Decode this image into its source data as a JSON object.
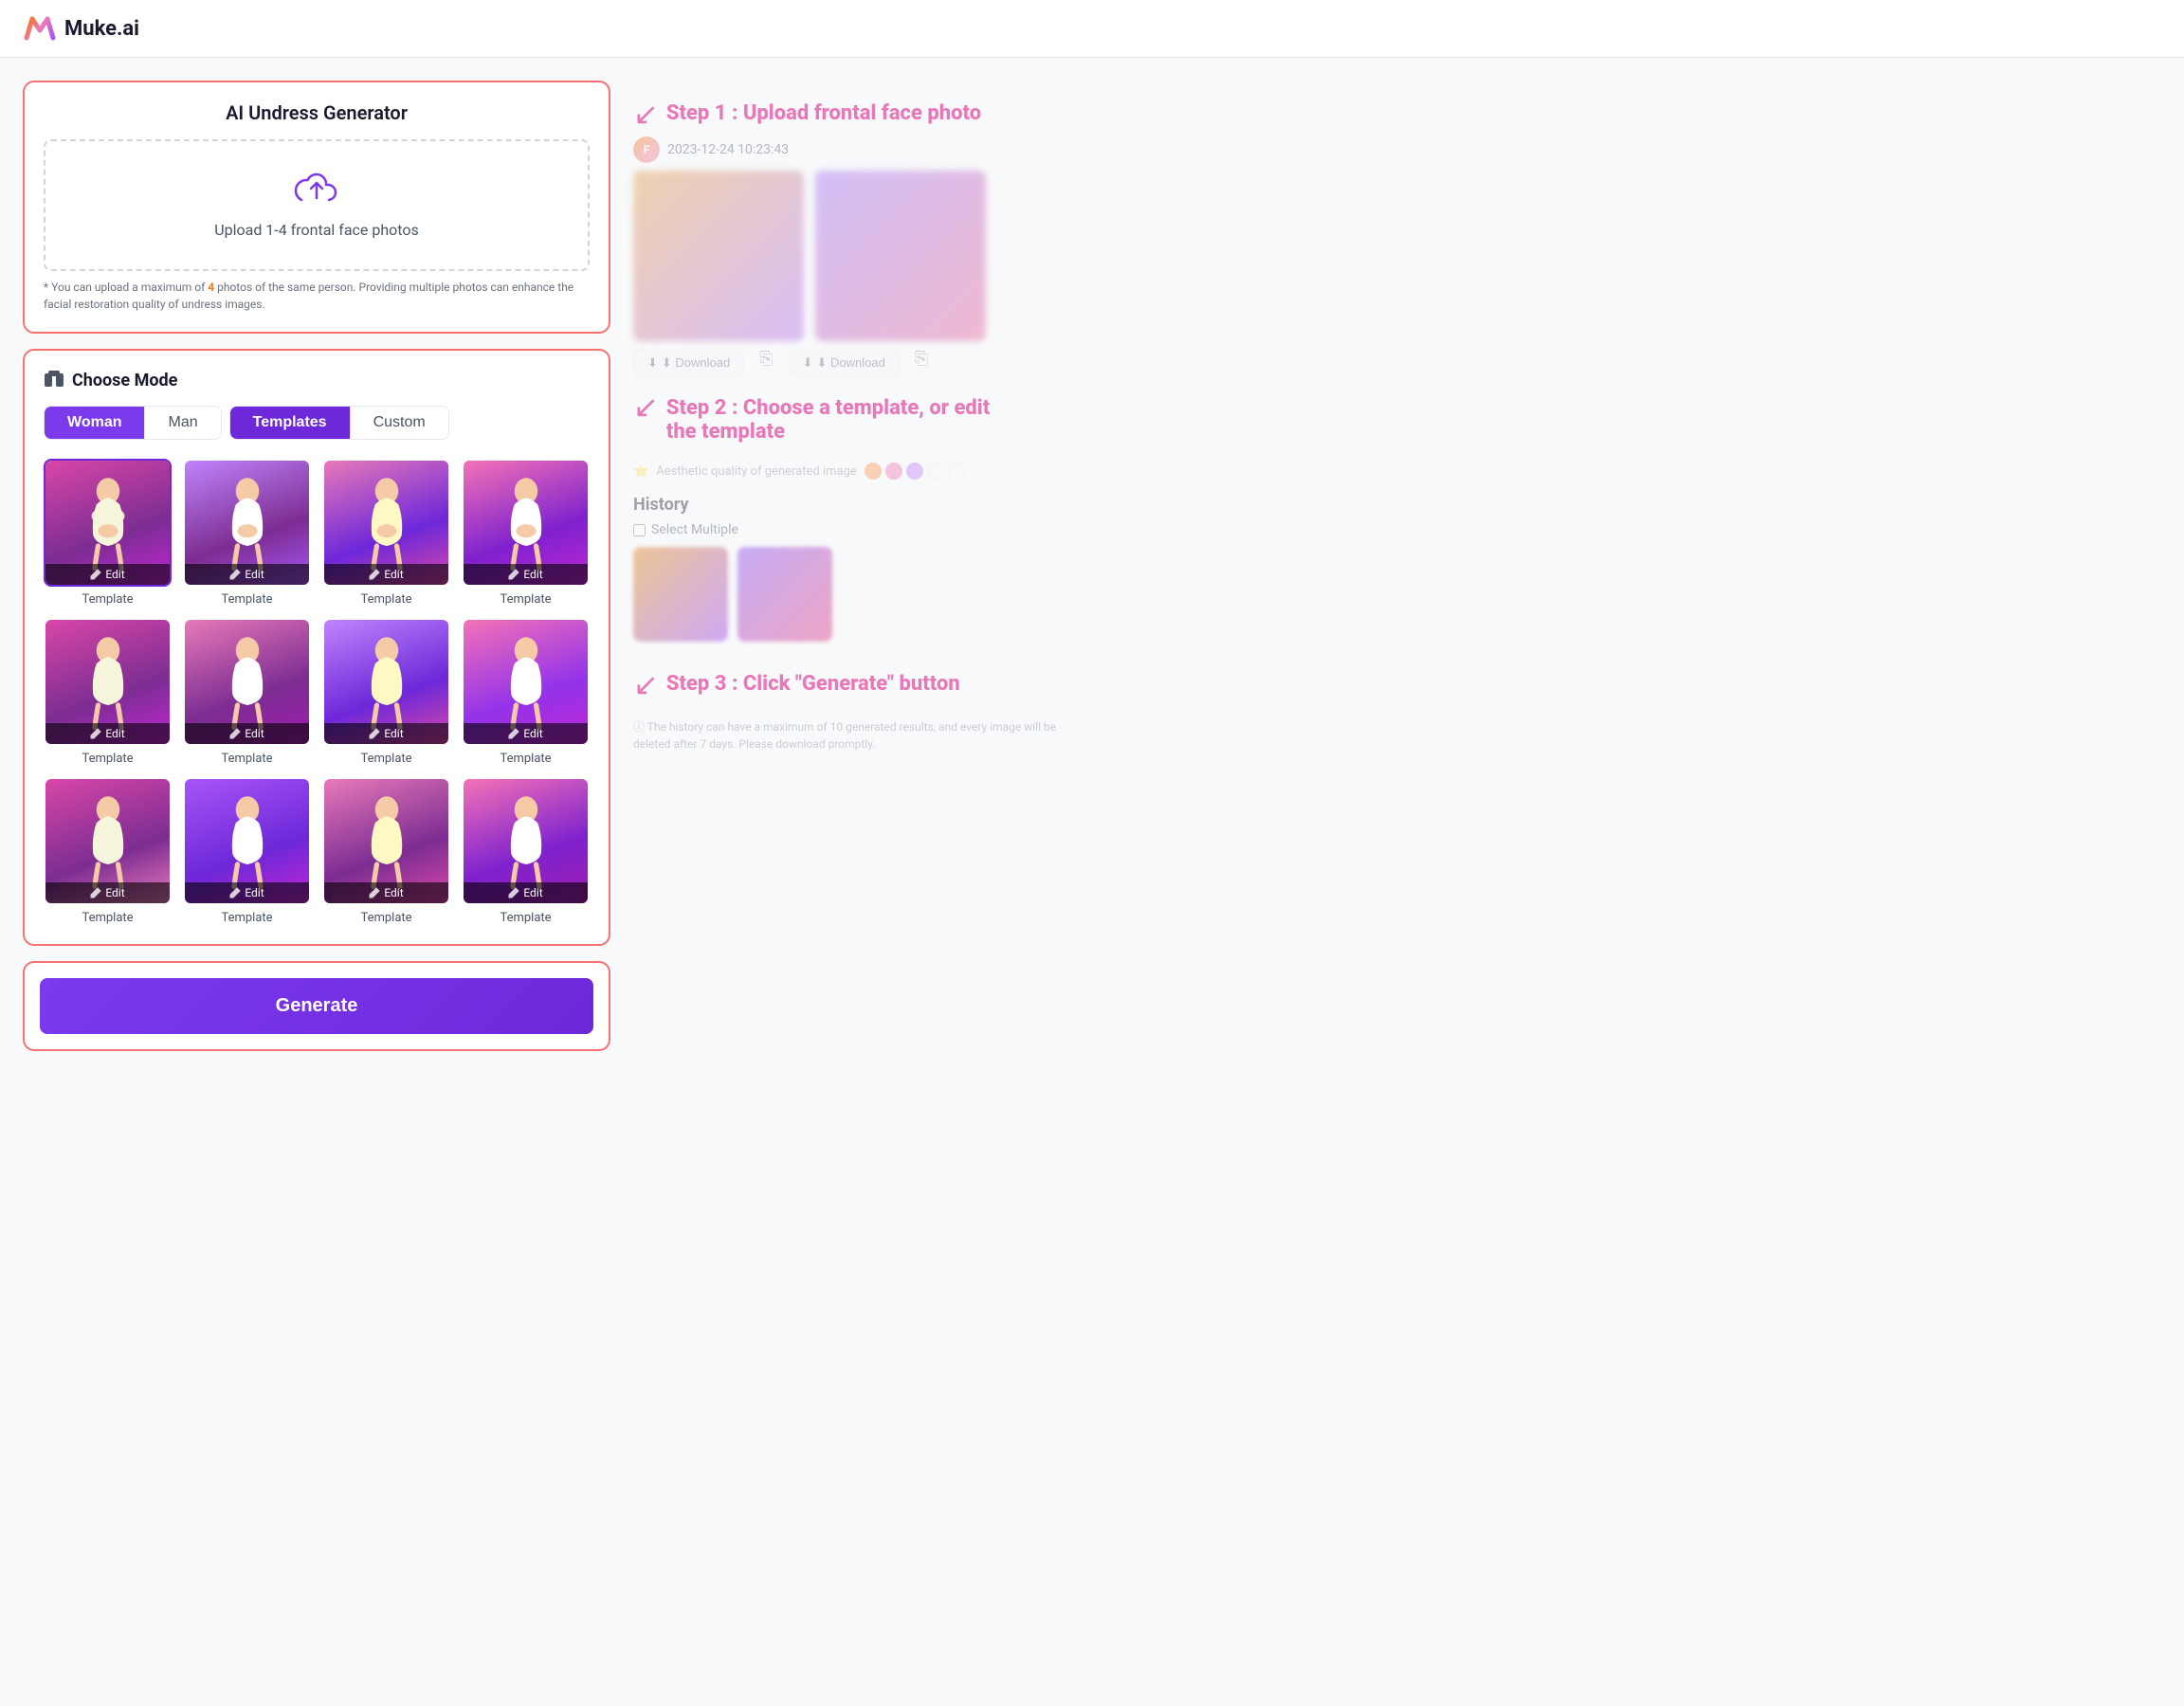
{
  "header": {
    "logo_text": "Muke.ai"
  },
  "upload_section": {
    "title": "AI Undress Generator",
    "upload_text": "Upload 1-4 frontal face photos",
    "hint": "* You can upload a maximum of 4 photos of the same person. Providing multiple photos can enhance the facial restoration quality of undress images.",
    "hint_number": "4"
  },
  "mode_section": {
    "title": "Choose Mode",
    "tabs_group1": [
      {
        "label": "Woman",
        "active": true
      },
      {
        "label": "Man",
        "active": false
      }
    ],
    "tabs_group2": [
      {
        "label": "Templates",
        "active": true
      },
      {
        "label": "Custom",
        "active": false
      }
    ]
  },
  "templates": {
    "items": [
      {
        "label": "Template",
        "edit_label": "Edit",
        "selected": true
      },
      {
        "label": "Template",
        "edit_label": "Edit",
        "selected": false
      },
      {
        "label": "Template",
        "edit_label": "Edit",
        "selected": false
      },
      {
        "label": "Template",
        "edit_label": "Edit",
        "selected": false
      },
      {
        "label": "Template",
        "edit_label": "Edit",
        "selected": false
      },
      {
        "label": "Template",
        "edit_label": "Edit",
        "selected": false
      },
      {
        "label": "Template",
        "edit_label": "Edit",
        "selected": false
      },
      {
        "label": "Template",
        "edit_label": "Edit",
        "selected": false
      },
      {
        "label": "Template",
        "edit_label": "Edit",
        "selected": false
      },
      {
        "label": "Template",
        "edit_label": "Edit",
        "selected": false
      },
      {
        "label": "Template",
        "edit_label": "Edit",
        "selected": false
      },
      {
        "label": "Template",
        "edit_label": "Edit",
        "selected": false
      }
    ]
  },
  "generate_btn": {
    "label": "Generate"
  },
  "steps": {
    "step1": "Step 1 : Upload frontal face photo",
    "step2": "Step 2 : Choose a template, or edit\nthe template",
    "step3": "Step 3 : Click \"Generate\" button"
  },
  "preview": {
    "timestamp": "2023-12-24 10:23:43",
    "download1": "⬇ Download",
    "download2": "⬇ Download",
    "quality_label": "Aesthetic quality of generated image"
  },
  "history": {
    "title": "History",
    "select_multiple": "Select Multiple"
  },
  "footer_note": "ⓘ The history can have a maximum of 10 generated results, and every image will be deleted after 7 days. Please download promptly."
}
